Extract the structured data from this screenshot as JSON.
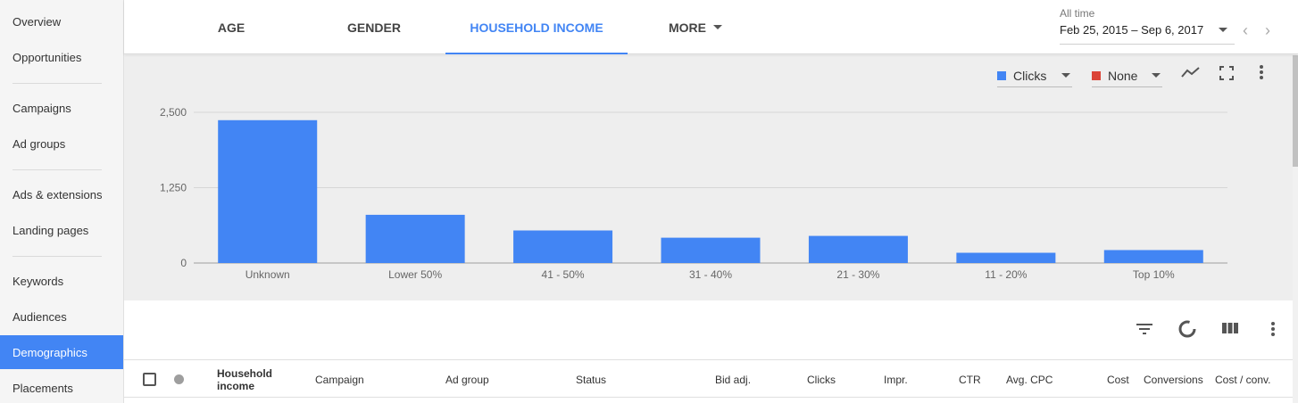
{
  "sidebar": {
    "items": [
      {
        "label": "Overview"
      },
      {
        "label": "Opportunities"
      },
      {
        "label": "Campaigns"
      },
      {
        "label": "Ad groups"
      },
      {
        "label": "Ads & extensions"
      },
      {
        "label": "Landing pages"
      },
      {
        "label": "Keywords"
      },
      {
        "label": "Audiences"
      },
      {
        "label": "Demographics",
        "active": true
      },
      {
        "label": "Placements"
      }
    ]
  },
  "tabs": [
    {
      "label": "Age"
    },
    {
      "label": "Gender"
    },
    {
      "label": "Household income",
      "active": true
    },
    {
      "label": "More"
    }
  ],
  "date": {
    "caption": "All time",
    "range": "Feb 25, 2015 – Sep 6, 2017"
  },
  "metrics": {
    "primary": {
      "label": "Clicks",
      "color": "#4285f4"
    },
    "secondary": {
      "label": "None",
      "color": "#db4437"
    }
  },
  "icons": [
    "line-chart-icon",
    "fullscreen-icon",
    "more-vert-icon",
    "filter-icon",
    "segment-icon",
    "columns-icon"
  ],
  "chart_data": {
    "type": "bar",
    "categories": [
      "Unknown",
      "Lower 50%",
      "41 - 50%",
      "31 - 40%",
      "21 - 30%",
      "11 - 20%",
      "Top 10%"
    ],
    "series": [
      {
        "name": "Clicks",
        "values": [
          2370,
          800,
          540,
          420,
          450,
          170,
          215
        ]
      }
    ],
    "yticks": [
      {
        "value": 0,
        "label": "0"
      },
      {
        "value": 1250,
        "label": "1,250"
      },
      {
        "value": 2500,
        "label": "2,500"
      }
    ],
    "ylim": [
      0,
      2500
    ],
    "grid": true,
    "color": "#4285f4"
  },
  "table": {
    "columns": [
      "Household income",
      "Campaign",
      "Ad group",
      "Status",
      "Bid adj.",
      "Clicks",
      "Impr.",
      "CTR",
      "Avg. CPC",
      "Cost",
      "Conversions",
      "Cost / conv."
    ]
  }
}
